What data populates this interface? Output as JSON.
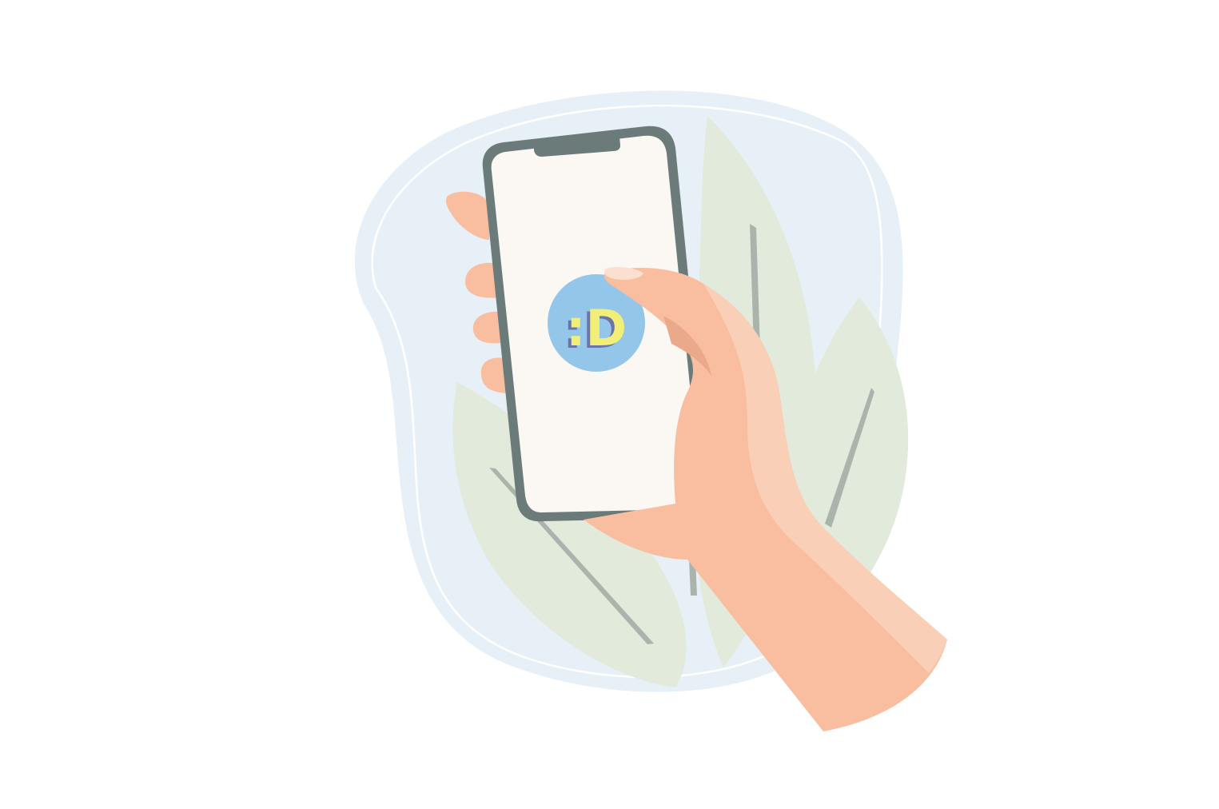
{
  "illustration": {
    "subject": "hand-holding-smartphone",
    "app_logo_text": ":D"
  },
  "colors": {
    "background": "#ffffff",
    "blob": "#e7f0f6",
    "blob_outline": "#ffffff",
    "leaf": "#e1eadb",
    "leaf_vein": "#aab4ad",
    "phone_frame": "#6b7b7a",
    "phone_screen": "#fbf8f3",
    "skin": "#f9bea0",
    "skin_highlight": "#f9cfb7",
    "skin_shadow": "#eaa98b",
    "nail": "#fbe0d2",
    "logo_circle": "#93c6e9",
    "logo_text": "#f2ef78",
    "logo_text_shadow": "#6a74a8"
  }
}
